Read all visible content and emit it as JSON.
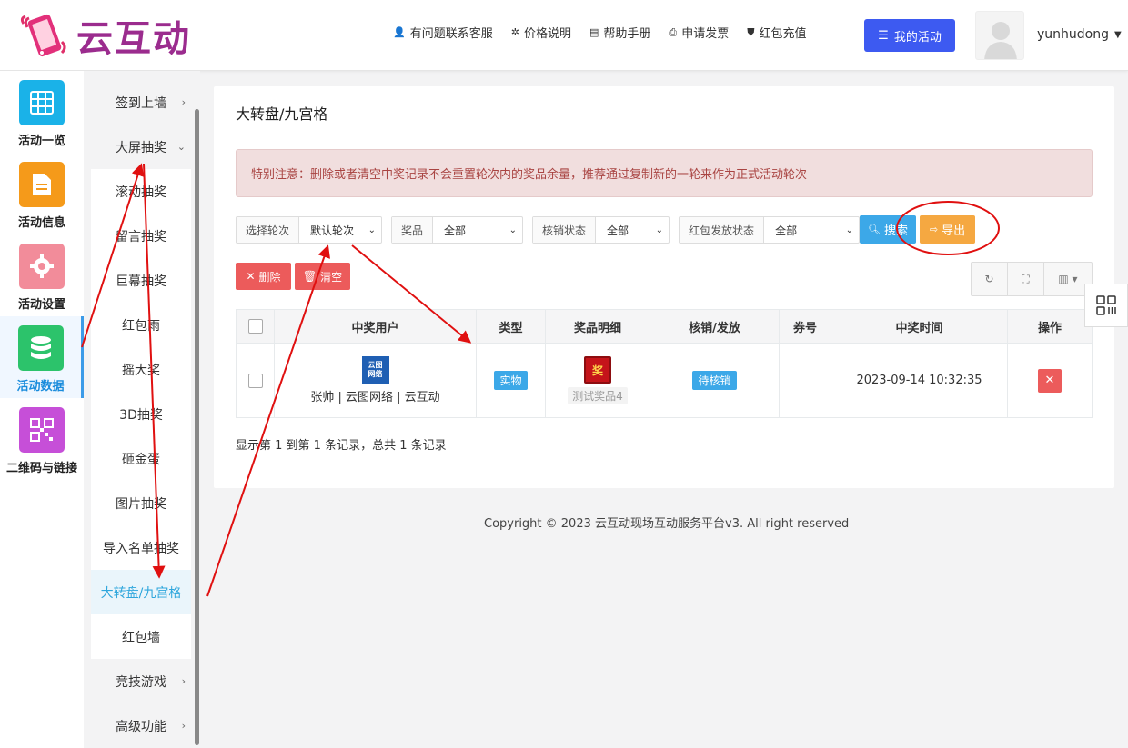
{
  "header": {
    "logo_text": "云互动",
    "nav": [
      {
        "label": "有问题联系客服",
        "icon": "add-user-icon"
      },
      {
        "label": "价格说明",
        "icon": "gear-badge-icon"
      },
      {
        "label": "帮助手册",
        "icon": "book-icon"
      },
      {
        "label": "申请发票",
        "icon": "printer-icon"
      },
      {
        "label": "红包充值",
        "icon": "shield-check-icon"
      }
    ],
    "my_activity_label": "我的活动",
    "username": "yunhudong"
  },
  "iconbar": {
    "items": [
      {
        "label": "活动一览",
        "color": "#1ab2e8",
        "icon": "grid-icon"
      },
      {
        "label": "活动信息",
        "color": "#f59a1a",
        "icon": "document-icon"
      },
      {
        "label": "活动设置",
        "color": "#f28c9a",
        "icon": "gear-icon"
      },
      {
        "label": "活动数据",
        "color": "#2cc36b",
        "icon": "database-icon"
      },
      {
        "label": "二维码与链接",
        "color": "#c64fd8",
        "icon": "qr-code-icon"
      }
    ]
  },
  "subbar": {
    "items": [
      {
        "label": "签到上墙",
        "chev": "›"
      },
      {
        "label": "大屏抽奖",
        "chev": "⌄"
      },
      {
        "label": "滚动抽奖"
      },
      {
        "label": "留言抽奖"
      },
      {
        "label": "巨幕抽奖"
      },
      {
        "label": "红包雨"
      },
      {
        "label": "摇大奖"
      },
      {
        "label": "3D抽奖"
      },
      {
        "label": "砸金蛋"
      },
      {
        "label": "图片抽奖"
      },
      {
        "label": "导入名单抽奖"
      },
      {
        "label": "大转盘/九宫格"
      },
      {
        "label": "红包墙"
      },
      {
        "label": "竞技游戏",
        "chev": "›"
      },
      {
        "label": "高级功能",
        "chev": "›"
      }
    ]
  },
  "main": {
    "title": "大转盘/九宫格",
    "notice": "特别注意：删除或者清空中奖记录不会重置轮次内的奖品余量，推荐通过复制新的一轮来作为正式活动轮次",
    "filters": [
      {
        "label": "选择轮次",
        "value": "默认轮次"
      },
      {
        "label": "奖品",
        "value": "全部"
      },
      {
        "label": "核销状态",
        "value": "全部"
      },
      {
        "label": "红包发放状态",
        "value": "全部"
      }
    ],
    "search_label": "搜索",
    "export_label": "导出",
    "delete_label": "删除",
    "clear_label": "清空",
    "table": {
      "headers": [
        "中奖用户",
        "类型",
        "奖品明细",
        "核销/发放",
        "券号",
        "中奖时间",
        "操作"
      ],
      "rows": [
        {
          "user_logo_line1": "云图",
          "user_logo_line2": "网络",
          "user": "张帅 | 云图网络 | 云互动",
          "type": "实物",
          "prize_icon": "奖",
          "prize": "测试奖品4",
          "status": "待核销",
          "coupon": "",
          "time": "2023-09-14 10:32:35"
        }
      ]
    },
    "records": "显示第 1 到第 1 条记录，总共 1 条记录"
  },
  "footer": {
    "copyright": "Copyright © 2023 云互动现场互动服务平台v3. All right reserved"
  }
}
